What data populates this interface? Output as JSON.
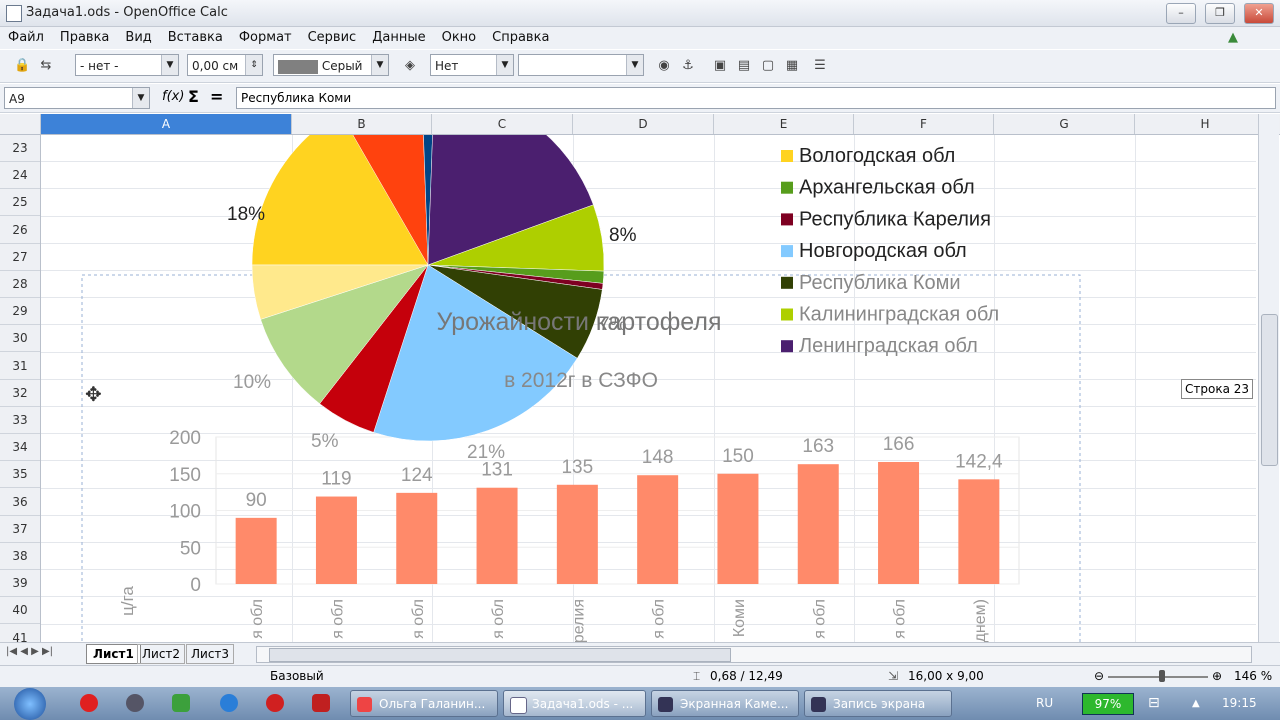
{
  "window": {
    "title": "Задача1.ods - OpenOffice Calc"
  },
  "menu": [
    "Файл",
    "Правка",
    "Вид",
    "Вставка",
    "Формат",
    "Сервис",
    "Данные",
    "Окно",
    "Справка"
  ],
  "toolbar": {
    "line_style": "- нет -",
    "line_width": "0,00 см",
    "line_color": "Серый",
    "fill": "Нет",
    "area": ""
  },
  "formula_bar": {
    "cell_ref": "A9",
    "content": "Республика Коми"
  },
  "columns": [
    "A",
    "B",
    "C",
    "D",
    "E",
    "F",
    "G",
    "H"
  ],
  "rows": [
    "23",
    "24",
    "25",
    "26",
    "27",
    "28",
    "29",
    "30",
    "31",
    "32",
    "33",
    "34",
    "35",
    "36",
    "37",
    "38",
    "39",
    "40",
    "41"
  ],
  "tooltip": "Строка 23",
  "pie": {
    "slices": [
      {
        "color": "#ffd320",
        "label": "18%"
      },
      {
        "color": "#ff420e",
        "label": ""
      },
      {
        "color": "#004586",
        "label": ""
      },
      {
        "color": "#4b1f6f",
        "label": ""
      },
      {
        "color": "#aecf00",
        "label": "8%"
      },
      {
        "color": "#579d1c",
        "label": ""
      },
      {
        "color": "#7e0021",
        "label": ""
      },
      {
        "color": "#314004",
        "label": "7%"
      },
      {
        "color": "#83caff",
        "label": "21%"
      },
      {
        "color": "#c5000b",
        "label": "5%"
      },
      {
        "color": "#b3d98b",
        "label": "10%"
      },
      {
        "color": "#ffe98c",
        "label": ""
      }
    ],
    "legend": [
      {
        "label": "Вологодская обл",
        "color": "#ffd320"
      },
      {
        "label": "Архангельская обл",
        "color": "#579d1c"
      },
      {
        "label": "Республика Карелия",
        "color": "#7e0021"
      },
      {
        "label": "Новгородская обл",
        "color": "#83caff"
      },
      {
        "label": "Республика Коми",
        "color": "#314004"
      },
      {
        "label": "Калининградская обл",
        "color": "#aecf00"
      },
      {
        "label": "Ленинградская обл",
        "color": "#4b1f6f"
      }
    ]
  },
  "chart_data": {
    "type": "bar",
    "title": "Урожайности картофеля",
    "subtitle": "в 2012г в СЗФО",
    "ylabel": "ц/га",
    "ylim": [
      0,
      200
    ],
    "yticks": [
      "0",
      "50",
      "100",
      "150",
      "200"
    ],
    "categories": [
      "я обл",
      "я обл",
      "я обл",
      "я обл",
      "релия",
      "я обл",
      "Коми",
      "я обл",
      "я обл",
      "днем)"
    ],
    "values": [
      90,
      119,
      124,
      131,
      135,
      148,
      150,
      163,
      166,
      142.4
    ],
    "value_labels": [
      "90",
      "119",
      "124",
      "131",
      "135",
      "148",
      "150",
      "163",
      "166",
      "142,4"
    ],
    "bar_color": "#ff8a6a"
  },
  "sheets": [
    "Лист1",
    "Лист2",
    "Лист3"
  ],
  "status": {
    "page_style": "Базовый",
    "position": "0,68 / 12,49",
    "size": "16,00 x 9,00",
    "zoom": "146 %"
  },
  "taskbar": {
    "tasks": [
      "Ольга Галанин...",
      "Задача1.ods - ...",
      "Экранная Каме...",
      "Запись экрана"
    ],
    "lang": "RU",
    "battery": "97%",
    "clock": "19:15"
  }
}
